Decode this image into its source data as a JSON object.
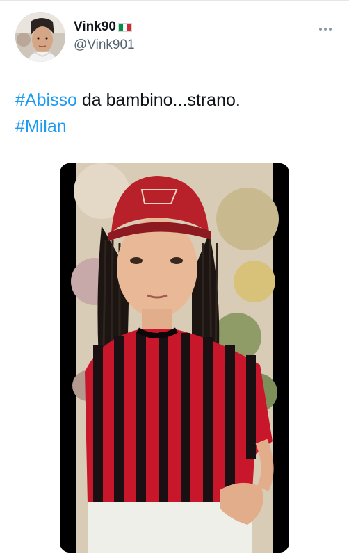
{
  "author": {
    "display_name": "Vink90",
    "flag_icon": "italy-flag-icon",
    "flag_colors": [
      "#009246",
      "#ffffff",
      "#ce2b37"
    ],
    "handle": "@Vink901"
  },
  "menu": {
    "icon": "more-horizontal-icon"
  },
  "tweet": {
    "hashtag_1": "#Abisso",
    "text_1": " da bambino...strano.",
    "hashtag_2": "#Milan"
  },
  "colors": {
    "hashtag": "#1d9bf0",
    "text": "#0f1419",
    "secondary": "#536471"
  }
}
